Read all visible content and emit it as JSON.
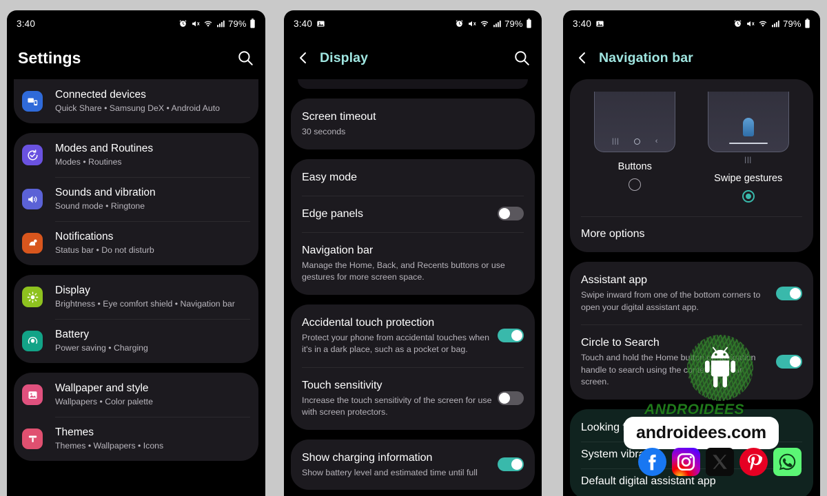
{
  "status_bar": {
    "time": "3:40",
    "battery_percent": "79%",
    "icons": [
      "alarm-icon",
      "mute-icon",
      "wifi-icon",
      "signal-icon",
      "battery-icon"
    ],
    "panel2_icons": [
      "screenshot-icon"
    ],
    "panel3_icons": [
      "screenshot-icon"
    ]
  },
  "colors": {
    "accent_teal": "#39b9ab",
    "title_teal": "#9fe5e0",
    "card_bg": "#1c1a1f",
    "screen_bg": "#000000",
    "teal_card_bg": "#10231f",
    "page_bg": "#c9c9c9"
  },
  "panel1": {
    "title": "Settings",
    "search_label": "Search",
    "groups": [
      {
        "items": [
          {
            "title": "Connected devices",
            "subtitle": "Quick Share  •  Samsung DeX  •  Android Auto",
            "icon": "connected-devices-icon",
            "icon_color": "#2f6ad9"
          }
        ]
      },
      {
        "items": [
          {
            "title": "Modes and Routines",
            "subtitle": "Modes  •  Routines",
            "icon": "modes-routines-icon",
            "icon_color": "#6a52e0"
          },
          {
            "title": "Sounds and vibration",
            "subtitle": "Sound mode  •  Ringtone",
            "icon": "sound-icon",
            "icon_color": "#5b62d6"
          },
          {
            "title": "Notifications",
            "subtitle": "Status bar  •  Do not disturb",
            "icon": "notifications-icon",
            "icon_color": "#d8561d"
          }
        ]
      },
      {
        "items": [
          {
            "title": "Display",
            "subtitle": "Brightness  •  Eye comfort shield  •  Navigation bar",
            "icon": "display-brightness-icon",
            "icon_color": "#8ec21f"
          },
          {
            "title": "Battery",
            "subtitle": "Power saving  •  Charging",
            "icon": "battery-icon",
            "icon_color": "#12a387"
          }
        ]
      },
      {
        "items": [
          {
            "title": "Wallpaper and style",
            "subtitle": "Wallpapers  •  Color palette",
            "icon": "wallpaper-icon",
            "icon_color": "#e0517e"
          },
          {
            "title": "Themes",
            "subtitle": "Themes  •  Wallpapers  •  Icons",
            "icon": "themes-icon",
            "icon_color": "#e05070"
          }
        ]
      }
    ]
  },
  "panel2": {
    "title": "Display",
    "back_label": "Back",
    "search_label": "Search",
    "groups": [
      {
        "items": [
          {
            "title": "Screen timeout",
            "subtitle": "30 seconds",
            "control": "none"
          }
        ]
      },
      {
        "items": [
          {
            "title": "Easy mode",
            "subtitle": "",
            "control": "none"
          },
          {
            "title": "Edge panels",
            "subtitle": "",
            "control": "toggle",
            "toggle_on": false
          },
          {
            "title": "Navigation bar",
            "subtitle": "Manage the Home, Back, and Recents buttons or use gestures for more screen space.",
            "control": "none"
          }
        ]
      },
      {
        "items": [
          {
            "title": "Accidental touch protection",
            "subtitle": "Protect your phone from accidental touches when it's in a dark place, such as a pocket or bag.",
            "control": "toggle",
            "toggle_on": true
          },
          {
            "title": "Touch sensitivity",
            "subtitle": "Increase the touch sensitivity of the screen for use with screen protectors.",
            "control": "toggle",
            "toggle_on": false
          }
        ]
      },
      {
        "items": [
          {
            "title": "Show charging information",
            "subtitle": "Show battery level and estimated time until full",
            "control": "toggle",
            "toggle_on": true
          }
        ]
      }
    ]
  },
  "panel3": {
    "title": "Navigation bar",
    "back_label": "Back",
    "nav_options": [
      {
        "label": "Buttons",
        "selected": false,
        "preview": "buttons-preview"
      },
      {
        "label": "Swipe gestures",
        "selected": true,
        "preview": "gestures-preview"
      }
    ],
    "more_options_label": "More options",
    "items": [
      {
        "title": "Assistant app",
        "subtitle": "Swipe inward from one of the bottom corners to open your digital assistant app.",
        "control": "toggle",
        "toggle_on": true
      },
      {
        "title": "Circle to Search",
        "subtitle": "Touch and hold the Home button or navigation handle to search using the content on your screen.",
        "control": "toggle",
        "toggle_on": true
      }
    ],
    "footer": {
      "heading": "Looking for something else?",
      "links": [
        "System vibration",
        "Default digital assistant app"
      ]
    }
  },
  "watermark": {
    "brand": "ANDROIDEES",
    "url": "androidees.com",
    "logo": "android-robot-icon",
    "social": [
      "facebook-icon",
      "instagram-icon",
      "x-icon",
      "pinterest-icon",
      "whatsapp-icon"
    ]
  }
}
